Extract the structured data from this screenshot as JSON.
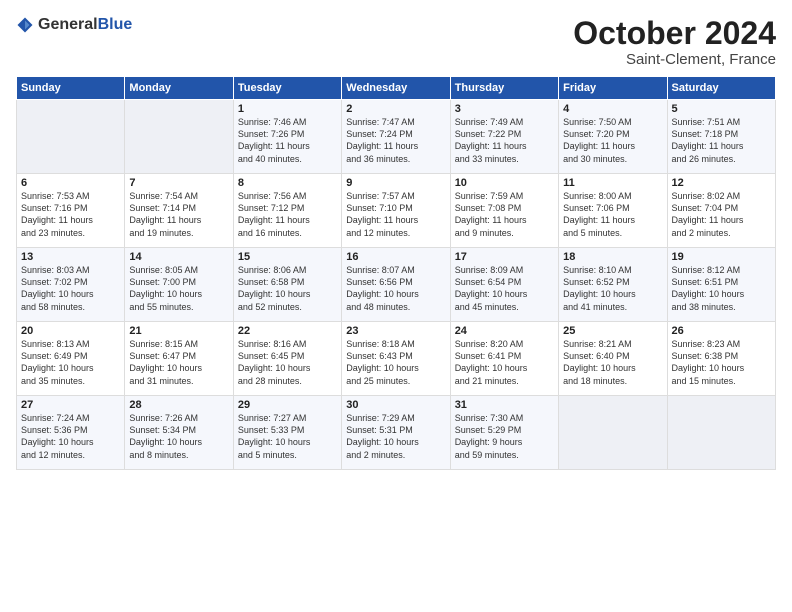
{
  "header": {
    "logo_general": "General",
    "logo_blue": "Blue",
    "month": "October 2024",
    "location": "Saint-Clement, France"
  },
  "weekdays": [
    "Sunday",
    "Monday",
    "Tuesday",
    "Wednesday",
    "Thursday",
    "Friday",
    "Saturday"
  ],
  "weeks": [
    [
      {
        "day": "",
        "info": ""
      },
      {
        "day": "",
        "info": ""
      },
      {
        "day": "1",
        "info": "Sunrise: 7:46 AM\nSunset: 7:26 PM\nDaylight: 11 hours\nand 40 minutes."
      },
      {
        "day": "2",
        "info": "Sunrise: 7:47 AM\nSunset: 7:24 PM\nDaylight: 11 hours\nand 36 minutes."
      },
      {
        "day": "3",
        "info": "Sunrise: 7:49 AM\nSunset: 7:22 PM\nDaylight: 11 hours\nand 33 minutes."
      },
      {
        "day": "4",
        "info": "Sunrise: 7:50 AM\nSunset: 7:20 PM\nDaylight: 11 hours\nand 30 minutes."
      },
      {
        "day": "5",
        "info": "Sunrise: 7:51 AM\nSunset: 7:18 PM\nDaylight: 11 hours\nand 26 minutes."
      }
    ],
    [
      {
        "day": "6",
        "info": "Sunrise: 7:53 AM\nSunset: 7:16 PM\nDaylight: 11 hours\nand 23 minutes."
      },
      {
        "day": "7",
        "info": "Sunrise: 7:54 AM\nSunset: 7:14 PM\nDaylight: 11 hours\nand 19 minutes."
      },
      {
        "day": "8",
        "info": "Sunrise: 7:56 AM\nSunset: 7:12 PM\nDaylight: 11 hours\nand 16 minutes."
      },
      {
        "day": "9",
        "info": "Sunrise: 7:57 AM\nSunset: 7:10 PM\nDaylight: 11 hours\nand 12 minutes."
      },
      {
        "day": "10",
        "info": "Sunrise: 7:59 AM\nSunset: 7:08 PM\nDaylight: 11 hours\nand 9 minutes."
      },
      {
        "day": "11",
        "info": "Sunrise: 8:00 AM\nSunset: 7:06 PM\nDaylight: 11 hours\nand 5 minutes."
      },
      {
        "day": "12",
        "info": "Sunrise: 8:02 AM\nSunset: 7:04 PM\nDaylight: 11 hours\nand 2 minutes."
      }
    ],
    [
      {
        "day": "13",
        "info": "Sunrise: 8:03 AM\nSunset: 7:02 PM\nDaylight: 10 hours\nand 58 minutes."
      },
      {
        "day": "14",
        "info": "Sunrise: 8:05 AM\nSunset: 7:00 PM\nDaylight: 10 hours\nand 55 minutes."
      },
      {
        "day": "15",
        "info": "Sunrise: 8:06 AM\nSunset: 6:58 PM\nDaylight: 10 hours\nand 52 minutes."
      },
      {
        "day": "16",
        "info": "Sunrise: 8:07 AM\nSunset: 6:56 PM\nDaylight: 10 hours\nand 48 minutes."
      },
      {
        "day": "17",
        "info": "Sunrise: 8:09 AM\nSunset: 6:54 PM\nDaylight: 10 hours\nand 45 minutes."
      },
      {
        "day": "18",
        "info": "Sunrise: 8:10 AM\nSunset: 6:52 PM\nDaylight: 10 hours\nand 41 minutes."
      },
      {
        "day": "19",
        "info": "Sunrise: 8:12 AM\nSunset: 6:51 PM\nDaylight: 10 hours\nand 38 minutes."
      }
    ],
    [
      {
        "day": "20",
        "info": "Sunrise: 8:13 AM\nSunset: 6:49 PM\nDaylight: 10 hours\nand 35 minutes."
      },
      {
        "day": "21",
        "info": "Sunrise: 8:15 AM\nSunset: 6:47 PM\nDaylight: 10 hours\nand 31 minutes."
      },
      {
        "day": "22",
        "info": "Sunrise: 8:16 AM\nSunset: 6:45 PM\nDaylight: 10 hours\nand 28 minutes."
      },
      {
        "day": "23",
        "info": "Sunrise: 8:18 AM\nSunset: 6:43 PM\nDaylight: 10 hours\nand 25 minutes."
      },
      {
        "day": "24",
        "info": "Sunrise: 8:20 AM\nSunset: 6:41 PM\nDaylight: 10 hours\nand 21 minutes."
      },
      {
        "day": "25",
        "info": "Sunrise: 8:21 AM\nSunset: 6:40 PM\nDaylight: 10 hours\nand 18 minutes."
      },
      {
        "day": "26",
        "info": "Sunrise: 8:23 AM\nSunset: 6:38 PM\nDaylight: 10 hours\nand 15 minutes."
      }
    ],
    [
      {
        "day": "27",
        "info": "Sunrise: 7:24 AM\nSunset: 5:36 PM\nDaylight: 10 hours\nand 12 minutes."
      },
      {
        "day": "28",
        "info": "Sunrise: 7:26 AM\nSunset: 5:34 PM\nDaylight: 10 hours\nand 8 minutes."
      },
      {
        "day": "29",
        "info": "Sunrise: 7:27 AM\nSunset: 5:33 PM\nDaylight: 10 hours\nand 5 minutes."
      },
      {
        "day": "30",
        "info": "Sunrise: 7:29 AM\nSunset: 5:31 PM\nDaylight: 10 hours\nand 2 minutes."
      },
      {
        "day": "31",
        "info": "Sunrise: 7:30 AM\nSunset: 5:29 PM\nDaylight: 9 hours\nand 59 minutes."
      },
      {
        "day": "",
        "info": ""
      },
      {
        "day": "",
        "info": ""
      }
    ]
  ]
}
